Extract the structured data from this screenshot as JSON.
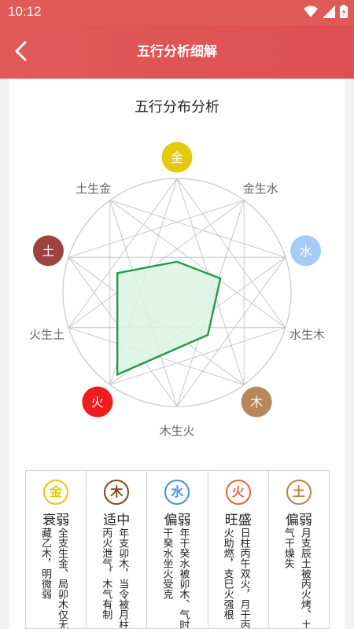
{
  "status_bar": {
    "time": "10:12"
  },
  "header": {
    "title": "五行分析细解"
  },
  "chart": {
    "title": "五行分布分析",
    "elements": [
      {
        "label": "金",
        "color": "#e5c90c"
      },
      {
        "label": "水",
        "color": "#a7cbf7"
      },
      {
        "label": "木",
        "color": "#b9875c"
      },
      {
        "label": "火",
        "color": "#ee1c1c"
      },
      {
        "label": "土",
        "color": "#9e4241"
      }
    ],
    "relations": [
      "金生水",
      "水生木",
      "木生火",
      "火生土",
      "土生金"
    ],
    "fill_color": "#d9f3e0",
    "stroke_color": "#1f9a4a"
  },
  "chart_data": {
    "type": "radar",
    "title": "五行分布分析",
    "axes": [
      "金",
      "水",
      "木",
      "火",
      "土"
    ],
    "values": [
      0.27,
      0.4,
      0.46,
      0.89,
      0.55
    ],
    "range": [
      0,
      1
    ]
  },
  "table": {
    "columns": [
      {
        "element": "金",
        "color": "#e5c90c",
        "status": "衰弱",
        "desc": "全支生金、局卯木仅无藏乙木，明微弱"
      },
      {
        "element": "木",
        "color": "#7d4a1f",
        "status": "适中",
        "desc": "年支卯木，当令被月柱丙火泄气，木气有制"
      },
      {
        "element": "水",
        "color": "#4b90d9",
        "status": "偏弱",
        "desc": "年干癸水被卯木、气时干癸水坐火受克"
      },
      {
        "element": "火",
        "color": "#e8623c",
        "status": "旺盛",
        "desc": "日柱丙午双火，月干丙火助燃，支巳火强根"
      },
      {
        "element": "土",
        "color": "#c3813a",
        "status": "偏弱",
        "desc": "月支辰土被丙火烤、土气干燥失"
      }
    ]
  }
}
